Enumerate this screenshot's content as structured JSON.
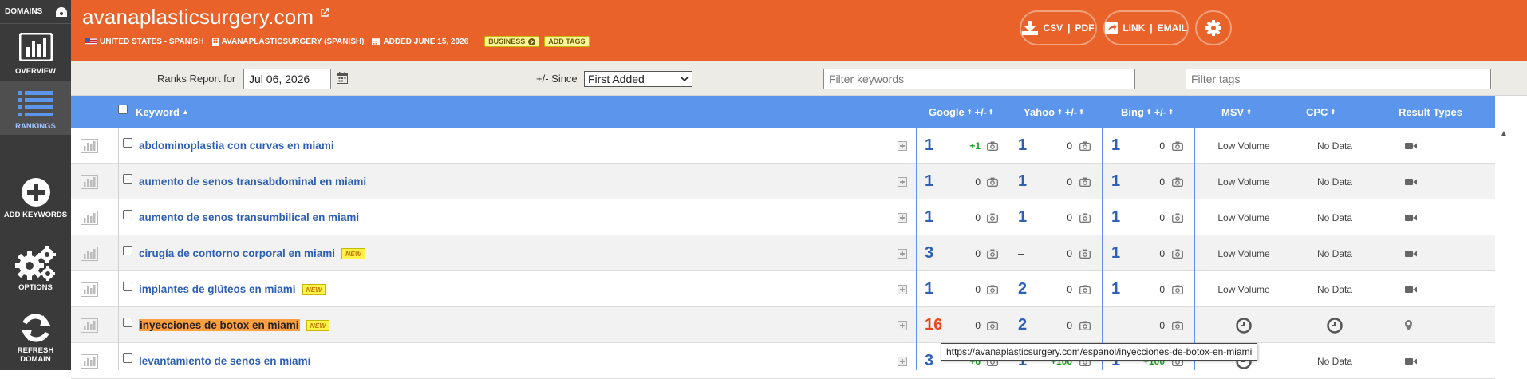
{
  "sidebar": {
    "domains_label": "DOMAINS",
    "items": [
      {
        "label": "OVERVIEW",
        "icon": "bar-chart-icon"
      },
      {
        "label": "RANKINGS",
        "icon": "list-icon",
        "active": true
      },
      {
        "label": "ADD KEYWORDS",
        "icon": "plus-circle-icon"
      },
      {
        "label": "OPTIONS",
        "icon": "gears-icon"
      },
      {
        "label": "REFRESH DOMAIN",
        "icon": "refresh-icon"
      }
    ]
  },
  "header": {
    "domain": "avanaplasticsurgery.com",
    "country": "UNITED STATES - SPANISH",
    "profile": "AVANAPLASTICSURGERY (SPANISH)",
    "added": "ADDED JUNE 15, 2026",
    "business_tag": "BUSINESS",
    "add_tags": "ADD TAGS",
    "export_csv": "CSV",
    "export_sep": "|",
    "export_pdf": "PDF",
    "share_link": "LINK",
    "share_sep": "|",
    "share_email": "EMAIL",
    "accent_color": "#e8622a"
  },
  "toolbar": {
    "ranks_report_label": "Ranks Report for",
    "date_value": "Jul 06, 2026",
    "since_label": "+/- Since",
    "since_value": "First Added",
    "filter_keywords_placeholder": "Filter keywords",
    "filter_tags_placeholder": "Filter tags"
  },
  "table": {
    "headers": {
      "keyword": "Keyword",
      "google": "Google",
      "google_chg": "+/-",
      "yahoo": "Yahoo",
      "yahoo_chg": "+/-",
      "bing": "Bing",
      "bing_chg": "+/-",
      "msv": "MSV",
      "cpc": "CPC",
      "result_types": "Result Types"
    },
    "rows": [
      {
        "keyword": "abdominoplastia con curvas en miami",
        "new": "",
        "google": "1",
        "g_chg": "+1",
        "yahoo": "1",
        "y_chg": "0",
        "bing": "1",
        "b_chg": "0",
        "msv": "Low Volume",
        "cpc": "No Data",
        "result": "video-icon"
      },
      {
        "keyword": "aumento de senos transabdominal en miami",
        "new": "",
        "google": "1",
        "g_chg": "0",
        "yahoo": "1",
        "y_chg": "0",
        "bing": "1",
        "b_chg": "0",
        "msv": "Low Volume",
        "cpc": "No Data",
        "result": "video-icon"
      },
      {
        "keyword": "aumento de senos transumbilical en miami",
        "new": "",
        "google": "1",
        "g_chg": "0",
        "yahoo": "1",
        "y_chg": "0",
        "bing": "1",
        "b_chg": "0",
        "msv": "Low Volume",
        "cpc": "No Data",
        "result": "video-icon"
      },
      {
        "keyword": "cirugía de contorno corporal en miami",
        "new": "NEW",
        "google": "3",
        "g_chg": "0",
        "yahoo": "–",
        "y_chg": "0",
        "bing": "1",
        "b_chg": "0",
        "msv": "Low Volume",
        "cpc": "No Data",
        "result": "video-icon"
      },
      {
        "keyword": "implantes de glúteos en miami",
        "new": "NEW",
        "google": "1",
        "g_chg": "0",
        "yahoo": "2",
        "y_chg": "0",
        "bing": "1",
        "b_chg": "0",
        "msv": "Low Volume",
        "cpc": "No Data",
        "result": "video-icon"
      },
      {
        "keyword": "inyecciones de botox en miami",
        "new": "NEW",
        "google": "16",
        "g_chg": "0",
        "yahoo": "2",
        "y_chg": "0",
        "bing": "–",
        "b_chg": "0",
        "msv": "",
        "cpc": "",
        "result": "map-pin-icon"
      },
      {
        "keyword": "levantamiento de senos en miami",
        "new": "",
        "google": "3",
        "g_chg": "+6",
        "yahoo": "1",
        "y_chg": "+100",
        "bing": "1",
        "b_chg": "+100",
        "msv": "",
        "cpc": "No Data",
        "result": "video-icon"
      }
    ]
  },
  "tooltip": "https://avanaplasticsurgery.com/espanol/inyecciones-de-botox-en-miami"
}
